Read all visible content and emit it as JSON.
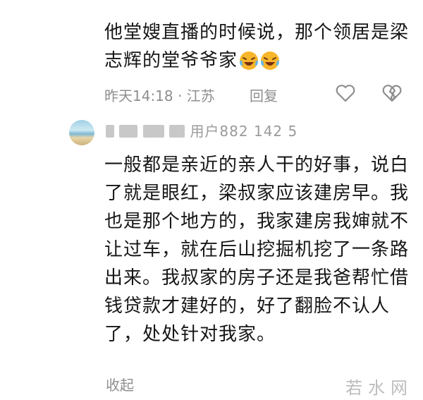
{
  "reply": {
    "text": "他堂嫂直播的时候说，那个领居是梁志辉的堂爷爷家",
    "emoji": "laughing-crying-emoji",
    "time": "昨天14:18 · 江苏",
    "reply_label": "回复",
    "like_icon": "heart-outline-icon",
    "dislike_icon": "broken-heart-outline-icon"
  },
  "comment": {
    "username": "用户882 142 5",
    "text": "一般都是亲近的亲人干的好事，说白了就是眼红，梁叔家应该建房早。我也是那个地方的，我家建房我婶就不让过车，就在后山挖掘机挖了一条路出来。我叔家的房子还是我爸帮忙借钱贷款才建好的，好了翻脸不认人了，处处针对我家。",
    "collapse_label": "收起"
  },
  "watermark": "若水网"
}
